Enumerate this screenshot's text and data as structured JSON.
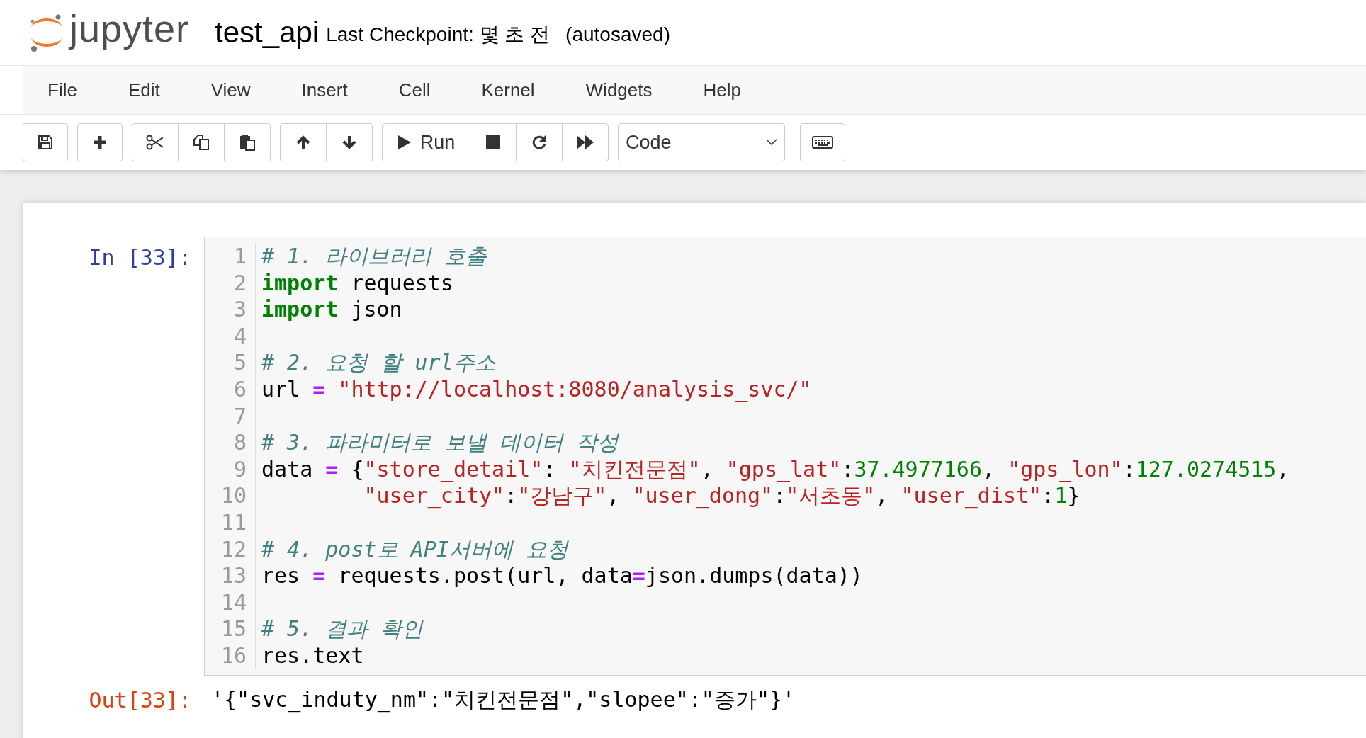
{
  "header": {
    "logo_text": "jupyter",
    "notebook_name": "test_api",
    "checkpoint": "Last Checkpoint: 몇 초 전",
    "autosave": "(autosaved)"
  },
  "menu": [
    "File",
    "Edit",
    "View",
    "Insert",
    "Cell",
    "Kernel",
    "Widgets",
    "Help"
  ],
  "toolbar": {
    "run_label": "Run",
    "cell_type": "Code"
  },
  "cell": {
    "prompt": "In [33]:",
    "lines": [
      {
        "number": "1",
        "tokens": [
          {
            "kind": "comment",
            "text": "# 1. 라이브러리 호출"
          }
        ]
      },
      {
        "number": "2",
        "tokens": [
          {
            "kind": "keyword",
            "text": "import"
          },
          {
            "kind": "plain",
            "text": " requests"
          }
        ]
      },
      {
        "number": "3",
        "tokens": [
          {
            "kind": "keyword",
            "text": "import"
          },
          {
            "kind": "plain",
            "text": " json"
          }
        ]
      },
      {
        "number": "4"
      },
      {
        "number": "5",
        "tokens": [
          {
            "kind": "comment",
            "text": "# 2. 요청 할 url주소"
          }
        ]
      },
      {
        "number": "6",
        "tokens": [
          {
            "kind": "plain",
            "text": "url "
          },
          {
            "kind": "operator",
            "text": "="
          },
          {
            "kind": "string",
            "text": " \"http://localhost:8080/analysis_svc/\""
          }
        ]
      },
      {
        "number": "7"
      },
      {
        "number": "8",
        "tokens": [
          {
            "kind": "comment",
            "text": "# 3. 파라미터로 보낼 데이터 작성"
          }
        ]
      },
      {
        "number": "9",
        "tokens": [
          {
            "kind": "plain",
            "text": "data "
          },
          {
            "kind": "operator",
            "text": "="
          },
          {
            "kind": "plain",
            "text": " {"
          },
          {
            "kind": "string",
            "text": "\"store_detail\""
          },
          {
            "kind": "plain",
            "text": ": "
          },
          {
            "kind": "string",
            "text": "\"치킨전문점\""
          },
          {
            "kind": "plain",
            "text": ", "
          },
          {
            "kind": "string",
            "text": "\"gps_lat\""
          },
          {
            "kind": "plain",
            "text": ":"
          },
          {
            "kind": "number",
            "text": "37.4977166"
          },
          {
            "kind": "plain",
            "text": ", "
          },
          {
            "kind": "string",
            "text": "\"gps_lon\""
          },
          {
            "kind": "plain",
            "text": ":"
          },
          {
            "kind": "number",
            "text": "127.0274515"
          },
          {
            "kind": "plain",
            "text": ","
          }
        ]
      },
      {
        "number": "10",
        "tokens": [
          {
            "kind": "string",
            "text": "        \"user_city\""
          },
          {
            "kind": "plain",
            "text": ":"
          },
          {
            "kind": "string",
            "text": "\"강남구\""
          },
          {
            "kind": "plain",
            "text": ", "
          },
          {
            "kind": "string",
            "text": "\"user_dong\""
          },
          {
            "kind": "plain",
            "text": ":"
          },
          {
            "kind": "string",
            "text": "\"서초동\""
          },
          {
            "kind": "plain",
            "text": ", "
          },
          {
            "kind": "string",
            "text": "\"user_dist\""
          },
          {
            "kind": "plain",
            "text": ":"
          },
          {
            "kind": "number",
            "text": "1"
          },
          {
            "kind": "plain",
            "text": "}"
          }
        ]
      },
      {
        "number": "11"
      },
      {
        "number": "12",
        "tokens": [
          {
            "kind": "comment",
            "text": "# 4. post로 API서버에 요청"
          }
        ]
      },
      {
        "number": "13",
        "tokens": [
          {
            "kind": "plain",
            "text": "res "
          },
          {
            "kind": "operator",
            "text": "="
          },
          {
            "kind": "plain",
            "text": " requests.post(url, data"
          },
          {
            "kind": "operator",
            "text": "="
          },
          {
            "kind": "plain",
            "text": "json.dumps(data))"
          }
        ]
      },
      {
        "number": "14"
      },
      {
        "number": "15",
        "tokens": [
          {
            "kind": "comment",
            "text": "# 5. 결과 확인"
          }
        ]
      },
      {
        "number": "16",
        "tokens": [
          {
            "kind": "plain",
            "text": "res.text"
          }
        ]
      }
    ],
    "output_prompt": "Out[33]:",
    "output": "'{\"svc_induty_nm\":\"치킨전문점\",\"slopee\":\"증가\"}'"
  }
}
